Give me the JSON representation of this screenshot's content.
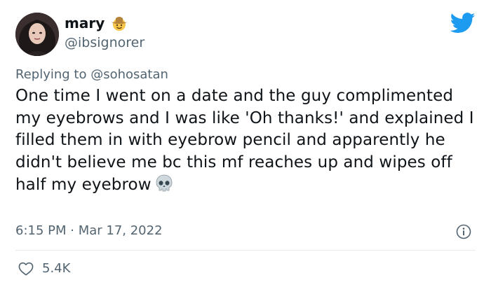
{
  "author": {
    "display_name": "mary",
    "handle": "@ibsignorer",
    "badge_icon": "cowboy-hat-face-icon"
  },
  "reply": {
    "prefix": "Replying to ",
    "mention": "@sohosatan"
  },
  "tweet": {
    "text": "One time I went on a date and the guy complimented my eyebrows and I was like 'Oh thanks!' and explained I filled them in with eyebrow pencil and apparently he didn't believe me bc this mf reaches up and wipes off half my eyebrow",
    "trailing_emoji_icon": "skull-icon",
    "timestamp": "6:15 PM · Mar 17, 2022"
  },
  "stats": {
    "likes": "5.4K"
  },
  "colors": {
    "brand": "#1d9bf0",
    "text": "#0f1419",
    "muted": "#536471",
    "divider": "#e6ecf0"
  }
}
